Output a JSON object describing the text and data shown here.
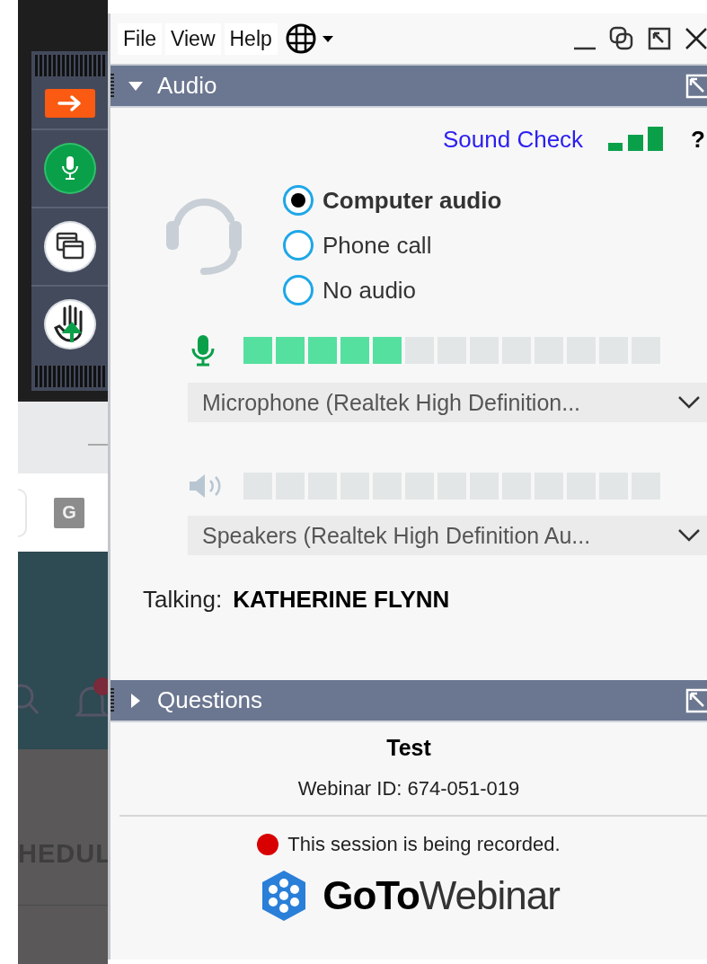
{
  "menu": [
    {
      "label": "File"
    },
    {
      "label": "View"
    },
    {
      "label": "Help"
    }
  ],
  "audio_panel": {
    "title": "Audio",
    "expanded": true,
    "sound_check": "Sound Check",
    "help": "?",
    "options": [
      {
        "label": "Computer audio",
        "selected": true
      },
      {
        "label": "Phone call",
        "selected": false
      },
      {
        "label": "No audio",
        "selected": false
      }
    ],
    "microphone": {
      "level": 0.385,
      "device": "Microphone (Realtek High Definition..."
    },
    "speakers": {
      "device": "Speakers (Realtek High Definition Au..."
    },
    "talking_label": "Talking:",
    "talking_name": "KATHERINE FLYNN"
  },
  "questions_panel": {
    "title": "Questions",
    "expanded": false
  },
  "session": {
    "title": "Test",
    "webinar_id": "Webinar ID: 674-051-019",
    "recording_notice": "This session is being recorded.",
    "logo": "**GoTo**Webinar"
  },
  "background": {
    "tile_letter": "G",
    "heading_fragment": "HEDUL"
  }
}
